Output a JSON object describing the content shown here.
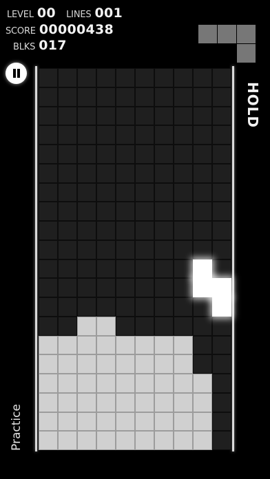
{
  "stats": {
    "level_label": "LEVEL",
    "level_value": "00",
    "lines_label": "LINES",
    "lines_value": "001",
    "score_label": "SCORE",
    "score_value": "00000438",
    "blocks_label": "BLKS",
    "blocks_value": "017"
  },
  "hold_label": "HOLD",
  "mode_label": "Practice",
  "icons": {
    "pause": "pause-icon"
  },
  "colors": {
    "background": "#000000",
    "empty_cell": "#1f1f1f",
    "locked_block": "#d0d0d0",
    "active_piece": "#ffffff",
    "preview": "#777777"
  },
  "board": {
    "columns": 10,
    "rows": 20,
    "column_heights": [
      6,
      6,
      7,
      7,
      6,
      6,
      6,
      6,
      4,
      0
    ],
    "active_piece": [
      [
        8,
        10
      ],
      [
        8,
        11
      ],
      [
        9,
        11
      ],
      [
        9,
        12
      ]
    ]
  },
  "next_piece": [
    [
      0,
      0
    ],
    [
      1,
      0
    ],
    [
      2,
      0
    ],
    [
      2,
      1
    ]
  ]
}
